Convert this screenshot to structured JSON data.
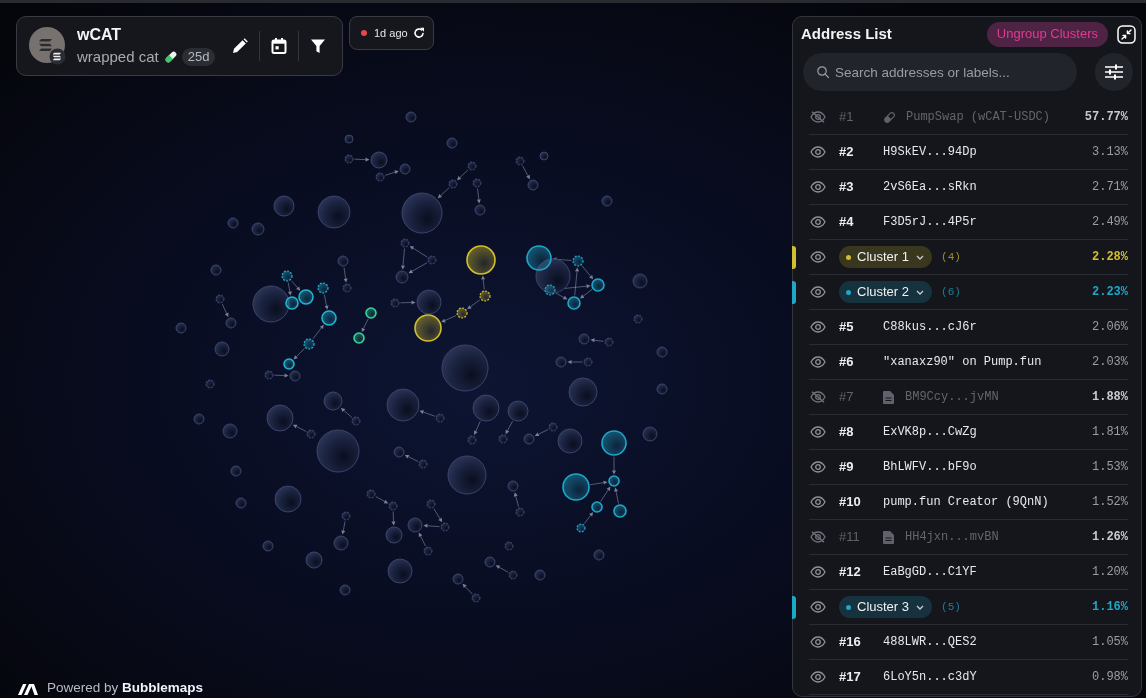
{
  "token": {
    "symbol": "wCAT",
    "name": "wrapped cat",
    "age": "25d"
  },
  "updated": {
    "text": "1d ago"
  },
  "address_list": {
    "title": "Address List",
    "ungroup_button": "Ungroup Clusters",
    "search": {
      "placeholder": "Search addresses or labels..."
    },
    "rows": [
      {
        "kind": "pool",
        "visible": false,
        "rank": "#1",
        "label": "PumpSwap (wCAT-USDC)",
        "percent": "57.77%"
      },
      {
        "kind": "wallet",
        "visible": true,
        "rank": "#2",
        "label": "H9SkEV...94Dp",
        "percent": "3.13%"
      },
      {
        "kind": "wallet",
        "visible": true,
        "rank": "#3",
        "label": "2vS6Ea...sRkn",
        "percent": "2.71%"
      },
      {
        "kind": "wallet",
        "visible": true,
        "rank": "#4",
        "label": "F3D5rJ...4P5r",
        "percent": "2.49%"
      },
      {
        "kind": "cluster",
        "visible": true,
        "label": "Cluster 1",
        "count": "(4)",
        "percent": "2.28%",
        "color": "#d2bf2d"
      },
      {
        "kind": "cluster",
        "visible": true,
        "label": "Cluster 2",
        "count": "(6)",
        "percent": "2.23%",
        "color": "#1ea7c6"
      },
      {
        "kind": "wallet",
        "visible": true,
        "rank": "#5",
        "label": "C88kus...cJ6r",
        "percent": "2.06%"
      },
      {
        "kind": "wallet",
        "visible": true,
        "rank": "#6",
        "label": "\"xanaxz90\" on Pump.fun",
        "percent": "2.03%"
      },
      {
        "kind": "contract",
        "visible": false,
        "rank": "#7",
        "label": "BM9Ccy...jvMN",
        "percent": "1.88%"
      },
      {
        "kind": "wallet",
        "visible": true,
        "rank": "#8",
        "label": "ExVK8p...CwZg",
        "percent": "1.81%"
      },
      {
        "kind": "wallet",
        "visible": true,
        "rank": "#9",
        "label": "BhLWFV...bF9o",
        "percent": "1.53%"
      },
      {
        "kind": "wallet",
        "visible": true,
        "rank": "#10",
        "label": "pump.fun Creator (9QnN)",
        "percent": "1.52%"
      },
      {
        "kind": "contract",
        "visible": false,
        "rank": "#11",
        "label": "HH4jxn...mvBN",
        "percent": "1.26%"
      },
      {
        "kind": "wallet",
        "visible": true,
        "rank": "#12",
        "label": "EaBgGD...C1YF",
        "percent": "1.20%"
      },
      {
        "kind": "cluster",
        "visible": true,
        "label": "Cluster 3",
        "count": "(5)",
        "percent": "1.16%",
        "color": "#1ea7c6"
      },
      {
        "kind": "wallet",
        "visible": true,
        "rank": "#16",
        "label": "488LWR...QES2",
        "percent": "1.05%"
      },
      {
        "kind": "wallet",
        "visible": true,
        "rank": "#17",
        "label": "6LoY5n...c3dY",
        "percent": "0.98%"
      }
    ]
  },
  "footer": {
    "text": "Powered by **Bubblemaps**"
  }
}
